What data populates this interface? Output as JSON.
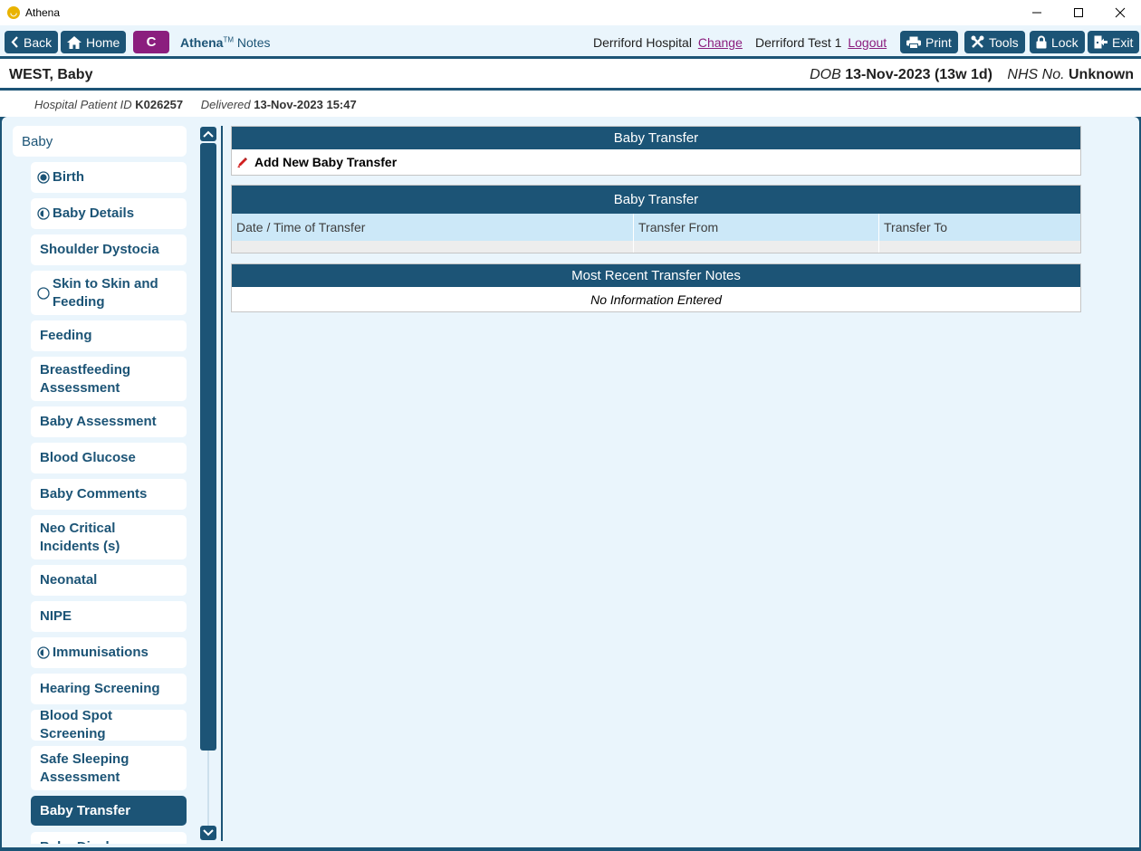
{
  "window": {
    "title": "Athena"
  },
  "toolbar": {
    "back": "Back",
    "home": "Home",
    "context": "C",
    "brand_name": "Athena",
    "brand_tm": "TM",
    "brand_suffix": "Notes",
    "hospital": "Derriford Hospital",
    "change": "Change",
    "user": "Derriford Test 1",
    "logout": "Logout",
    "print": "Print",
    "tools": "Tools",
    "lock": "Lock",
    "exit": "Exit"
  },
  "patient": {
    "name": "WEST, Baby",
    "dob_label": "DOB",
    "dob_value": "13-Nov-2023 (13w 1d)",
    "nhs_label": "NHS No.",
    "nhs_value": "Unknown",
    "hosp_id_label": "Hospital Patient ID",
    "hosp_id_value": "K026257",
    "delivered_label": "Delivered",
    "delivered_value": "13-Nov-2023 15:47"
  },
  "sidebar": {
    "section": "Baby",
    "items": [
      {
        "label": "Birth",
        "status": "complete-icon"
      },
      {
        "label": "Baby Details",
        "status": "partial-icon"
      },
      {
        "label": "Shoulder Dystocia",
        "status": ""
      },
      {
        "label": "Skin to Skin and Feeding",
        "status": "empty-icon"
      },
      {
        "label": "Feeding",
        "status": ""
      },
      {
        "label": "Breastfeeding Assessment",
        "status": ""
      },
      {
        "label": "Baby Assessment",
        "status": ""
      },
      {
        "label": "Blood Glucose",
        "status": ""
      },
      {
        "label": "Baby Comments",
        "status": ""
      },
      {
        "label": "Neo Critical Incidents (s)",
        "status": ""
      },
      {
        "label": "Neonatal",
        "status": ""
      },
      {
        "label": "NIPE",
        "status": ""
      },
      {
        "label": "Immunisations",
        "status": "partial-icon"
      },
      {
        "label": "Hearing Screening",
        "status": ""
      },
      {
        "label": "Blood Spot Screening",
        "status": ""
      },
      {
        "label": "Safe Sleeping Assessment",
        "status": ""
      },
      {
        "label": "Baby Transfer",
        "status": "",
        "active": true
      },
      {
        "label": "Baby Discharge",
        "status": ""
      }
    ]
  },
  "content": {
    "add_panel_title": "Baby Transfer",
    "add_link": "Add New Baby Transfer",
    "table_title": "Baby Transfer",
    "columns": [
      "Date / Time of Transfer",
      "Transfer From",
      "Transfer To"
    ],
    "notes_title": "Most Recent Transfer Notes",
    "notes_empty": "No Information Entered"
  },
  "colors": {
    "primary": "#1c5476",
    "accent": "#8b1e7e",
    "background": "#eaf5fc"
  }
}
